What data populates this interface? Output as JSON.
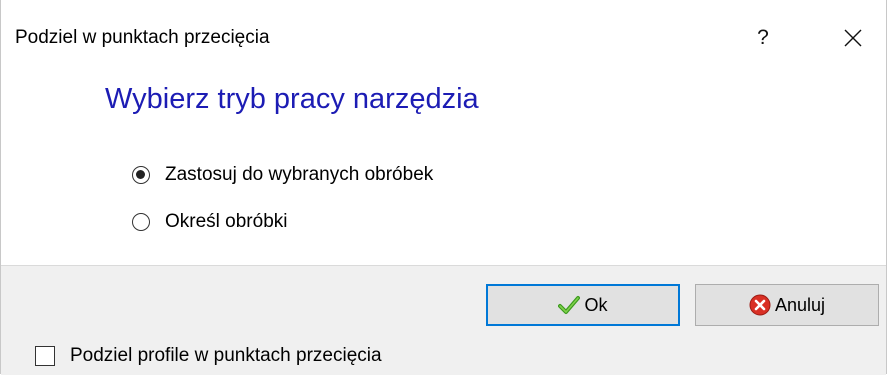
{
  "window": {
    "title": "Podziel w punktach przecięcia",
    "help_label": "?"
  },
  "heading": "Wybierz tryb pracy narzędzia",
  "options": [
    {
      "label": "Zastosuj do wybranych obróbek",
      "selected": true
    },
    {
      "label": "Określ obróbki",
      "selected": false
    }
  ],
  "buttons": {
    "ok_label": "Ok",
    "cancel_label": "Anuluj"
  },
  "checkbox": {
    "label": "Podziel profile w punktach przecięcia",
    "checked": false
  },
  "colors": {
    "heading": "#1c1cb4",
    "default_button_border": "#0078d7",
    "footer_background": "#f0f0f0"
  }
}
